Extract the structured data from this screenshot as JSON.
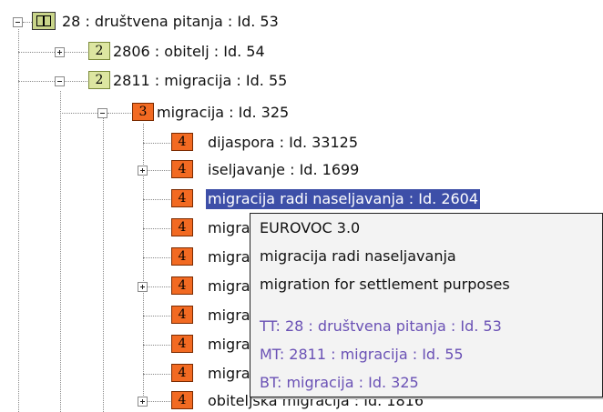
{
  "tree": {
    "nodes": [
      {
        "level_badge": "",
        "label": "28 : društvena pitanja : Id. 53"
      },
      {
        "level_badge": "2",
        "label": "2806 : obitelj : Id. 54"
      },
      {
        "level_badge": "2",
        "label": "2811 : migracija : Id. 55"
      },
      {
        "level_badge": "3",
        "label": "migracija : Id. 325"
      },
      {
        "level_badge": "4",
        "label": "dijaspora : Id. 33125"
      },
      {
        "level_badge": "4",
        "label": "iseljavanje : Id. 1699"
      },
      {
        "level_badge": "4",
        "label": "migracija radi naseljavanja : Id. 2604"
      },
      {
        "level_badge": "4",
        "label": "migra"
      },
      {
        "level_badge": "4",
        "label": "migra"
      },
      {
        "level_badge": "4",
        "label": "migra"
      },
      {
        "level_badge": "4",
        "label": "migra"
      },
      {
        "level_badge": "4",
        "label": "migra"
      },
      {
        "level_badge": "4",
        "label": "migra"
      },
      {
        "level_badge": "4",
        "label": "obiteljska migracija : Id. 1816"
      }
    ]
  },
  "tooltip": {
    "title": "EUROVOC 3.0",
    "term_hr": "migracija radi naseljavanja",
    "term_en": "migration for settlement purposes",
    "tt": "TT: 28 : društvena pitanja : Id. 53",
    "mt": "MT: 2811 : migracija : Id. 55",
    "bt": "BT: migracija : Id. 325"
  },
  "colors": {
    "selection": "#3d4fa8",
    "badge_orange": "#f26a22",
    "badge_green": "#dde6a1",
    "tooltip_link": "#6a51b5"
  },
  "icons": [
    "book-icon",
    "expander-minus-icon",
    "expander-plus-icon"
  ]
}
